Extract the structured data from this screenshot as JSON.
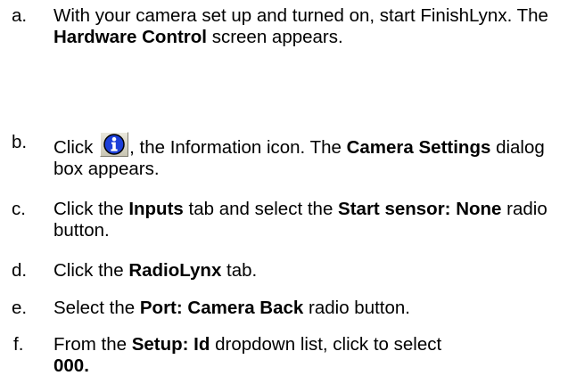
{
  "steps": [
    {
      "letter": "a.",
      "t1": "With your camera set up and turned on, start FinishLynx. The ",
      "b1": "Hardware Control",
      "t2": " screen appears."
    },
    {
      "letter": "b.",
      "t1": "Click ",
      "t2": ", the Information icon. The ",
      "b1": "Camera Settings",
      "t3": " dialog box appears."
    },
    {
      "letter": "c.",
      "t1": "Click the ",
      "b1": "Inputs",
      "t2": " tab and select the ",
      "b2": "Start sensor: None",
      "t3": " radio button."
    },
    {
      "letter": "d.",
      "t1": "Click the ",
      "b1": "RadioLynx",
      "t2": " tab."
    },
    {
      "letter": "e.",
      "t1": "Select the ",
      "b1": "Port: Camera Back",
      "t2": " radio button."
    },
    {
      "letter": "f.",
      "t1": "From the ",
      "b1": "Setup: Id",
      "t2": " dropdown list, click to select ",
      "b2": "000."
    }
  ],
  "icons": {
    "information": "info-icon",
    "icon_color": "#1c3fd8"
  }
}
